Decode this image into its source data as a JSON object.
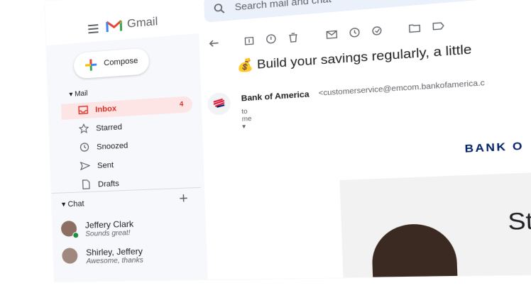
{
  "header": {
    "brand": "Gmail",
    "search_placeholder": "Search mail and chat"
  },
  "sidebar": {
    "compose_label": "Compose",
    "mail_header": "Mail",
    "items": [
      {
        "label": "Inbox",
        "count": "4"
      },
      {
        "label": "Starred"
      },
      {
        "label": "Snoozed"
      },
      {
        "label": "Sent"
      },
      {
        "label": "Drafts"
      }
    ],
    "chat_header": "Chat",
    "chats": [
      {
        "name": "Jeffery Clark",
        "status": "Sounds great!"
      },
      {
        "name": "Shirley, Jeffery",
        "status": "Awesome, thanks"
      }
    ]
  },
  "email": {
    "subject": "Build your savings regularly, a little",
    "sender_name": "Bank of America",
    "sender_email": "<customerservice@emcom.bankofamerica.c",
    "to_line": "to me",
    "brand_mark": "BANK O",
    "hero_word": "Ste"
  },
  "colors": {
    "accent_red": "#d93025",
    "inbox_bg": "#fde5e5",
    "bank_blue": "#012169"
  }
}
